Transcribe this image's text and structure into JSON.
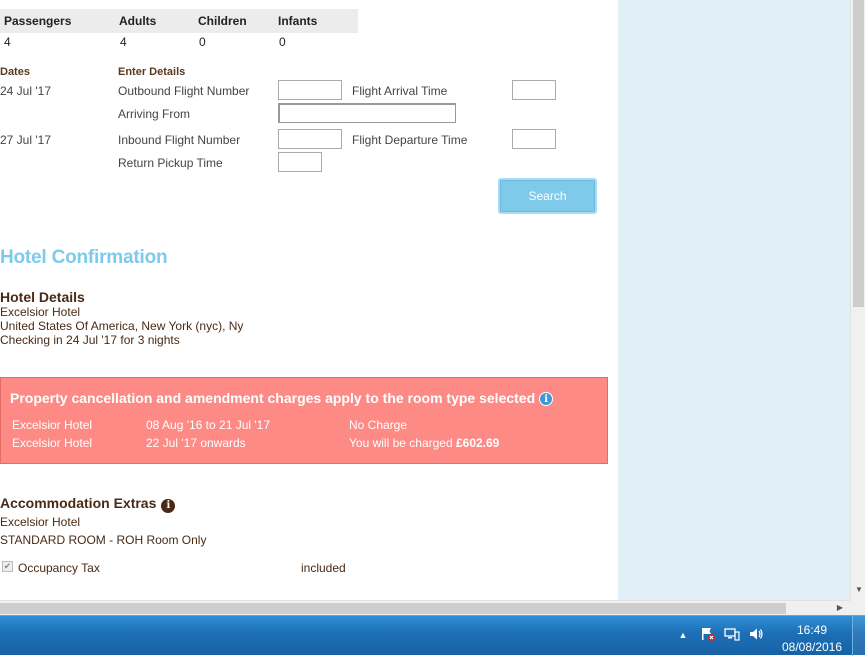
{
  "passengers": {
    "headers": [
      "Passengers",
      "Adults",
      "Children",
      "Infants"
    ],
    "values": [
      "4",
      "4",
      "0",
      "0"
    ]
  },
  "flight_form": {
    "dates_label": "Dates",
    "enter_details_label": "Enter Details",
    "outbound_date": "24 Jul '17",
    "inbound_date": "27 Jul '17",
    "outbound_flight_label": "Outbound Flight Number",
    "flight_arrival_label": "Flight Arrival Time",
    "arriving_from_label": "Arriving From",
    "inbound_flight_label": "Inbound Flight Number",
    "flight_departure_label": "Flight Departure Time",
    "return_pickup_label": "Return Pickup Time",
    "search_button": "Search"
  },
  "hotel_confirmation": {
    "title": "Hotel Confirmation",
    "details_title": "Hotel Details",
    "hotel_name": "Excelsior Hotel",
    "location": "United States Of America, New York (nyc), Ny",
    "checking_in": "Checking in 24 Jul '17 for 3 nights"
  },
  "cancellation": {
    "title": "Property cancellation and amendment charges apply to the room type selected",
    "info_icon": "info-icon",
    "rows": [
      {
        "hotel": "Excelsior Hotel",
        "dates": "08 Aug '16 to 21 Jul '17",
        "charge_prefix": "No Charge",
        "charge_amount": ""
      },
      {
        "hotel": "Excelsior Hotel",
        "dates": "22 Jul '17 onwards",
        "charge_prefix": "You will be charged ",
        "charge_amount": "£602.69"
      }
    ]
  },
  "extras": {
    "title": "Accommodation Extras",
    "hotel_name": "Excelsior Hotel",
    "room": "STANDARD ROOM - ROH Room Only",
    "item_label": "Occupancy Tax",
    "item_value": "included"
  },
  "taskbar": {
    "time": "16:49",
    "date": "08/08/2016"
  },
  "colors": {
    "accent_blue": "#7ccbec",
    "cancel_bg": "#fd8a85",
    "brown_text": "#4a2a14",
    "side_panel": "#e1f0f7",
    "taskbar": "#1d6fb5"
  }
}
